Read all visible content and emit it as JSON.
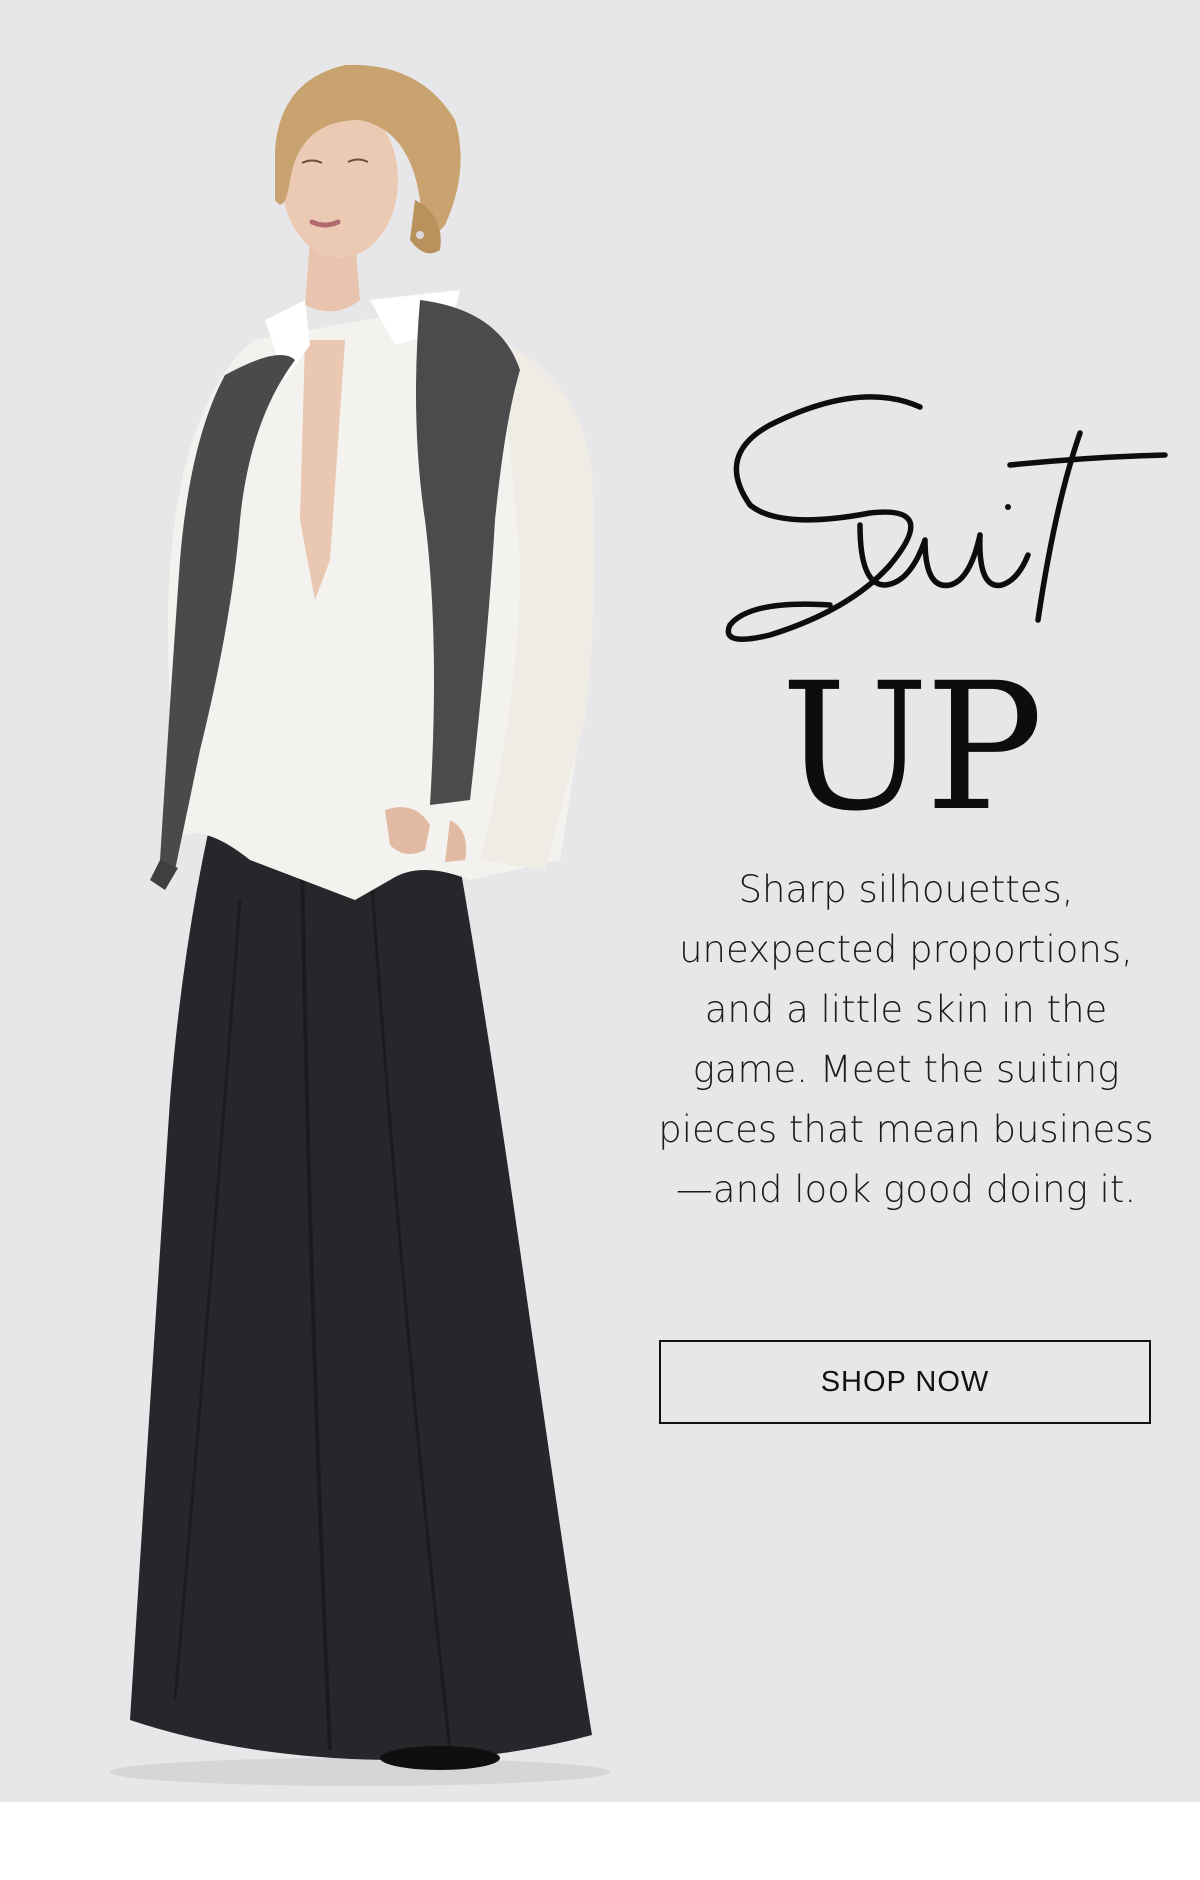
{
  "hero": {
    "script_word": "Suit",
    "headline": "UP",
    "body": "Sharp silhouettes, unexpected proportions, and a little skin in the game. Meet the suiting pieces that mean business—and look good doing it.",
    "cta_label": "SHOP NOW"
  },
  "colors": {
    "background": "#e7e7e9",
    "text": "#111111",
    "button_border": "#111111"
  }
}
